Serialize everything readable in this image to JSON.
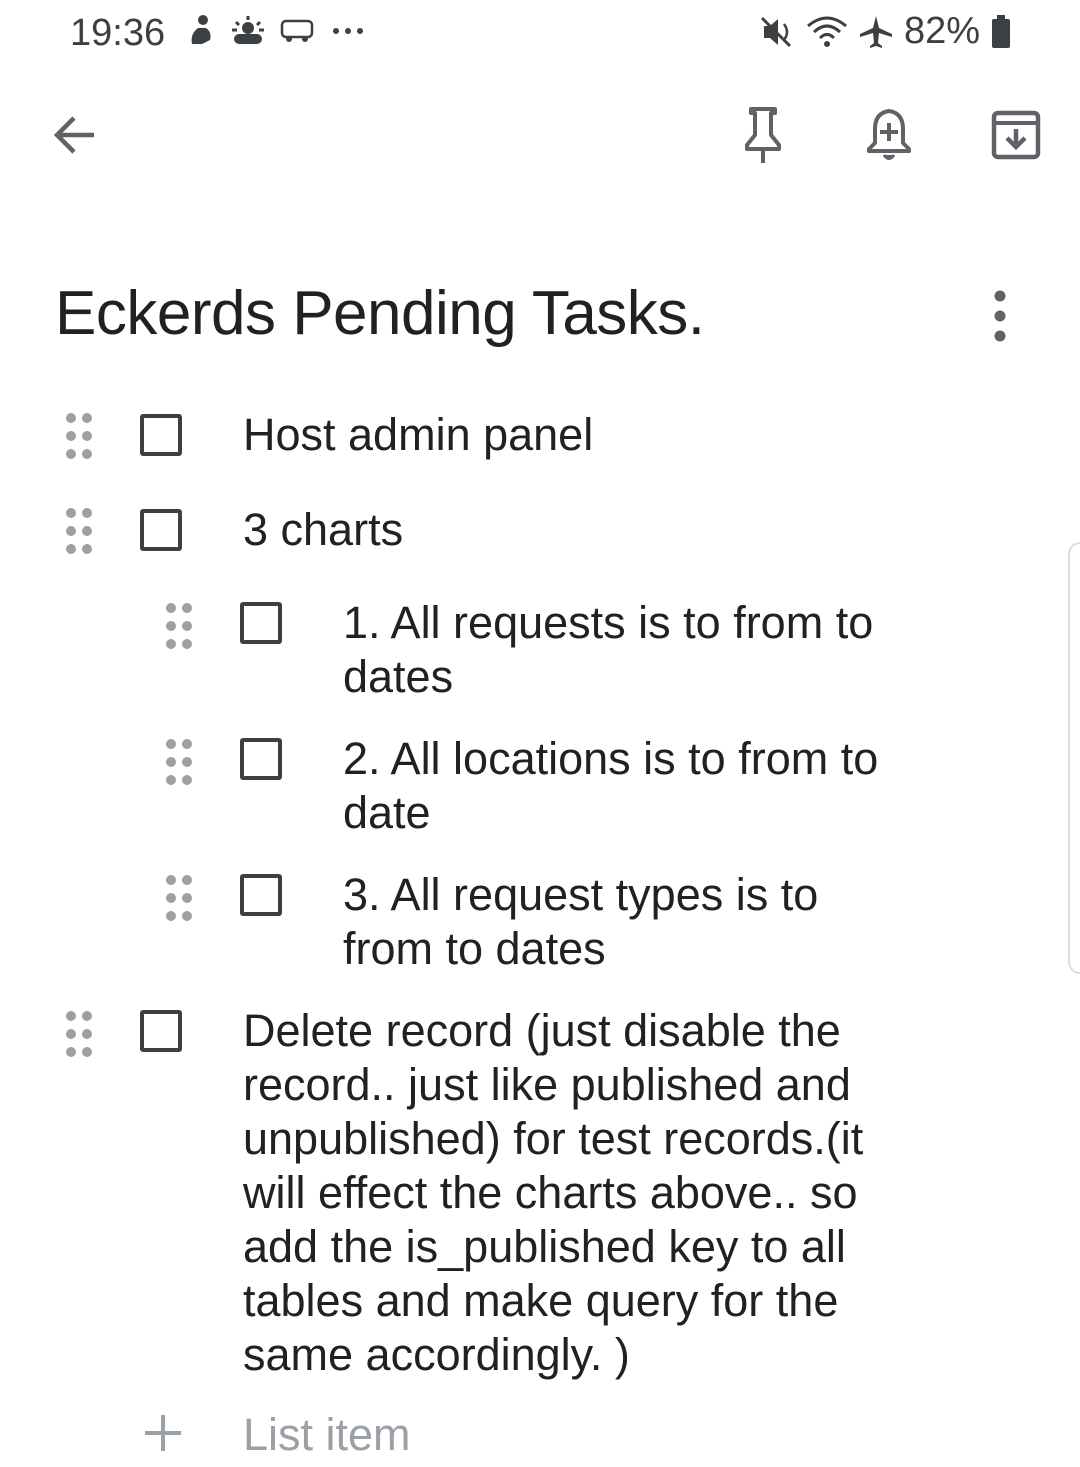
{
  "status_bar": {
    "time": "19:36",
    "battery": "82%",
    "left_icons": [
      "person-icon",
      "weather-icon",
      "redbus-icon",
      "more-dots-icon"
    ],
    "right_icons": [
      "mute-icon",
      "wifi-icon",
      "airplane-icon",
      "battery-icon"
    ]
  },
  "toolbar": {
    "back_icon": "arrow-left-icon",
    "actions": [
      "pin-icon",
      "reminder-icon",
      "archive-icon"
    ]
  },
  "note": {
    "title": "Eckerds Pending Tasks.",
    "items": [
      {
        "text": "Host admin panel",
        "checked": false,
        "indent": 0
      },
      {
        "text": "3 charts",
        "checked": false,
        "indent": 0
      },
      {
        "text": "1. All requests is to from to dates",
        "checked": false,
        "indent": 1
      },
      {
        "text": "2. All locations is to from to date",
        "checked": false,
        "indent": 1
      },
      {
        "text": "3. All request types is to from to dates",
        "checked": false,
        "indent": 1
      },
      {
        "text": "Delete record (just disable the record.. just like published and unpublished) for test records.(it will effect the charts above.. so add the is_published key to all tables and make query for the same accordingly. )",
        "checked": false,
        "indent": 0
      }
    ],
    "add_item_placeholder": "List item"
  },
  "colors": {
    "icon": "#5f6368",
    "text": "#202124",
    "placeholder": "#9aa0a6"
  }
}
